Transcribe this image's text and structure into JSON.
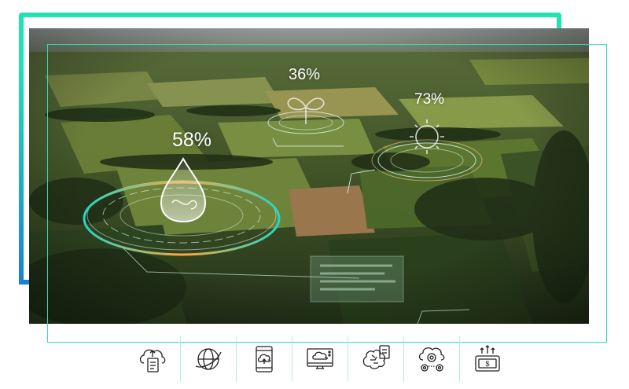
{
  "colors": {
    "accent_green": "#20e3b2",
    "accent_blue": "#1a7fd4",
    "hud_cyan": "#7ff3e6",
    "hud_orange": "#ff9a3c",
    "frame_line": "#35d9c6"
  },
  "hud": {
    "water": {
      "percent": "58%",
      "icon": "water-drop-icon"
    },
    "plant": {
      "percent": "36%",
      "icon": "sprout-icon"
    },
    "sun": {
      "percent": "73%",
      "icon": "sun-icon"
    }
  },
  "icons": [
    "cloud-document-icon",
    "globe-icon",
    "tablet-upload-icon",
    "monitor-cloud-icon",
    "brain-circuit-icon",
    "cloud-gears-icon",
    "money-growth-icon"
  ]
}
